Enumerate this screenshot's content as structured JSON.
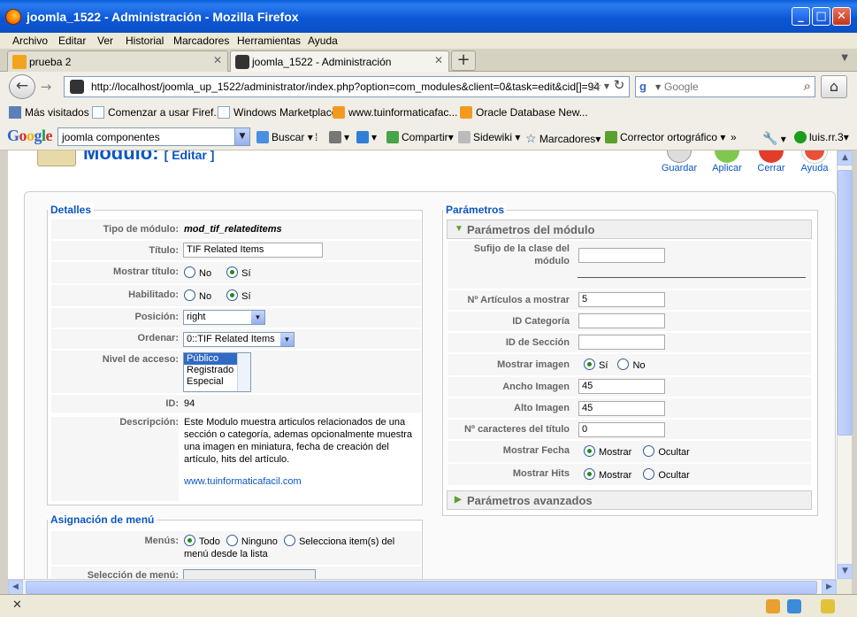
{
  "window": {
    "title": "joomla_1522 - Administración - Mozilla Firefox"
  },
  "menu": [
    "Archivo",
    "Editar",
    "Ver",
    "Historial",
    "Marcadores",
    "Herramientas",
    "Ayuda"
  ],
  "tabs": [
    {
      "title": "prueba 2"
    },
    {
      "title": "joomla_1522 - Administración"
    }
  ],
  "nav": {
    "url": "http://localhost/joomla_up_1522/administrator/index.php?option=com_modules&client=0&task=edit&cid[]=94",
    "search_placeholder": "Google"
  },
  "bookmarks": [
    "Más visitados",
    "Comenzar a usar Firef...",
    "Windows Marketplace",
    "www.tuinformaticafac...",
    "Oracle Database New..."
  ],
  "googlebar": {
    "logo": [
      "G",
      "o",
      "o",
      "g",
      "l",
      "e"
    ],
    "query": "joomla componentes",
    "buttons": [
      "Buscar",
      "Compartir",
      "Sidewiki",
      "Marcadores",
      "Corrector ortográfico",
      "»",
      "luis.rr.3"
    ]
  },
  "page": {
    "title": "Módulo:",
    "edit_label": "[ Editar ]",
    "toolbar": [
      "Guardar",
      "Aplicar",
      "Cerrar",
      "Ayuda"
    ]
  },
  "details": {
    "legend": "Detalles",
    "tipo_label": "Tipo de módulo:",
    "tipo_value": "mod_tif_relateditems",
    "titulo_label": "Título:",
    "titulo_value": "TIF Related Items",
    "mostrar_label": "Mostrar título:",
    "habilitado_label": "Habilitado:",
    "no": "No",
    "si": "Sí",
    "posicion_label": "Posición:",
    "posicion_value": "right",
    "ordenar_label": "Ordenar:",
    "ordenar_value": "0::TIF Related Items",
    "nivel_label": "Nivel de acceso:",
    "nivel_options": [
      "Público",
      "Registrado",
      "Especial"
    ],
    "id_label": "ID:",
    "id_value": "94",
    "desc_label": "Descripción:",
    "desc_value": "Este Modulo muestra articulos relacionados de una sección o categoría, ademas opcionalmente muestra una imagen en miniatura, fecha de creación del artículo, hits del artículo.",
    "link": "www.tuinformaticafacil.com"
  },
  "menu_assign": {
    "legend": "Asignación de menú",
    "menus_label": "Menús:",
    "todo": "Todo",
    "ninguno": "Ninguno",
    "selecciona": "Selecciona item(s) del menú desde la lista",
    "seleccion_label": "Selección de menú:"
  },
  "params": {
    "legend": "Parámetros",
    "module_tab": "Parámetros del módulo",
    "advanced_tab": "Parámetros avanzados",
    "sufijo_label": "Sufijo de la clase del módulo",
    "sufijo_value": "",
    "articulos_label": "Nº Artículos a mostrar",
    "articulos_value": "5",
    "categoria_label": "ID Categoría",
    "categoria_value": "",
    "seccion_label": "ID de Sección",
    "seccion_value": "",
    "imagen_label": "Mostrar imagen",
    "si": "Sí",
    "no": "No",
    "ancho_label": "Ancho Imagen",
    "ancho_value": "45",
    "alto_label": "Alto Imagen",
    "alto_value": "45",
    "caracteres_label": "Nº caracteres del título",
    "caracteres_value": "0",
    "fecha_label": "Mostrar Fecha",
    "hits_label": "Mostrar Hits",
    "mostrar": "Mostrar",
    "ocultar": "Ocultar"
  },
  "colors": {
    "accent": "#0b55c4",
    "radio_on": "#1d8b1d",
    "titlebar": "#0a5fd8"
  }
}
